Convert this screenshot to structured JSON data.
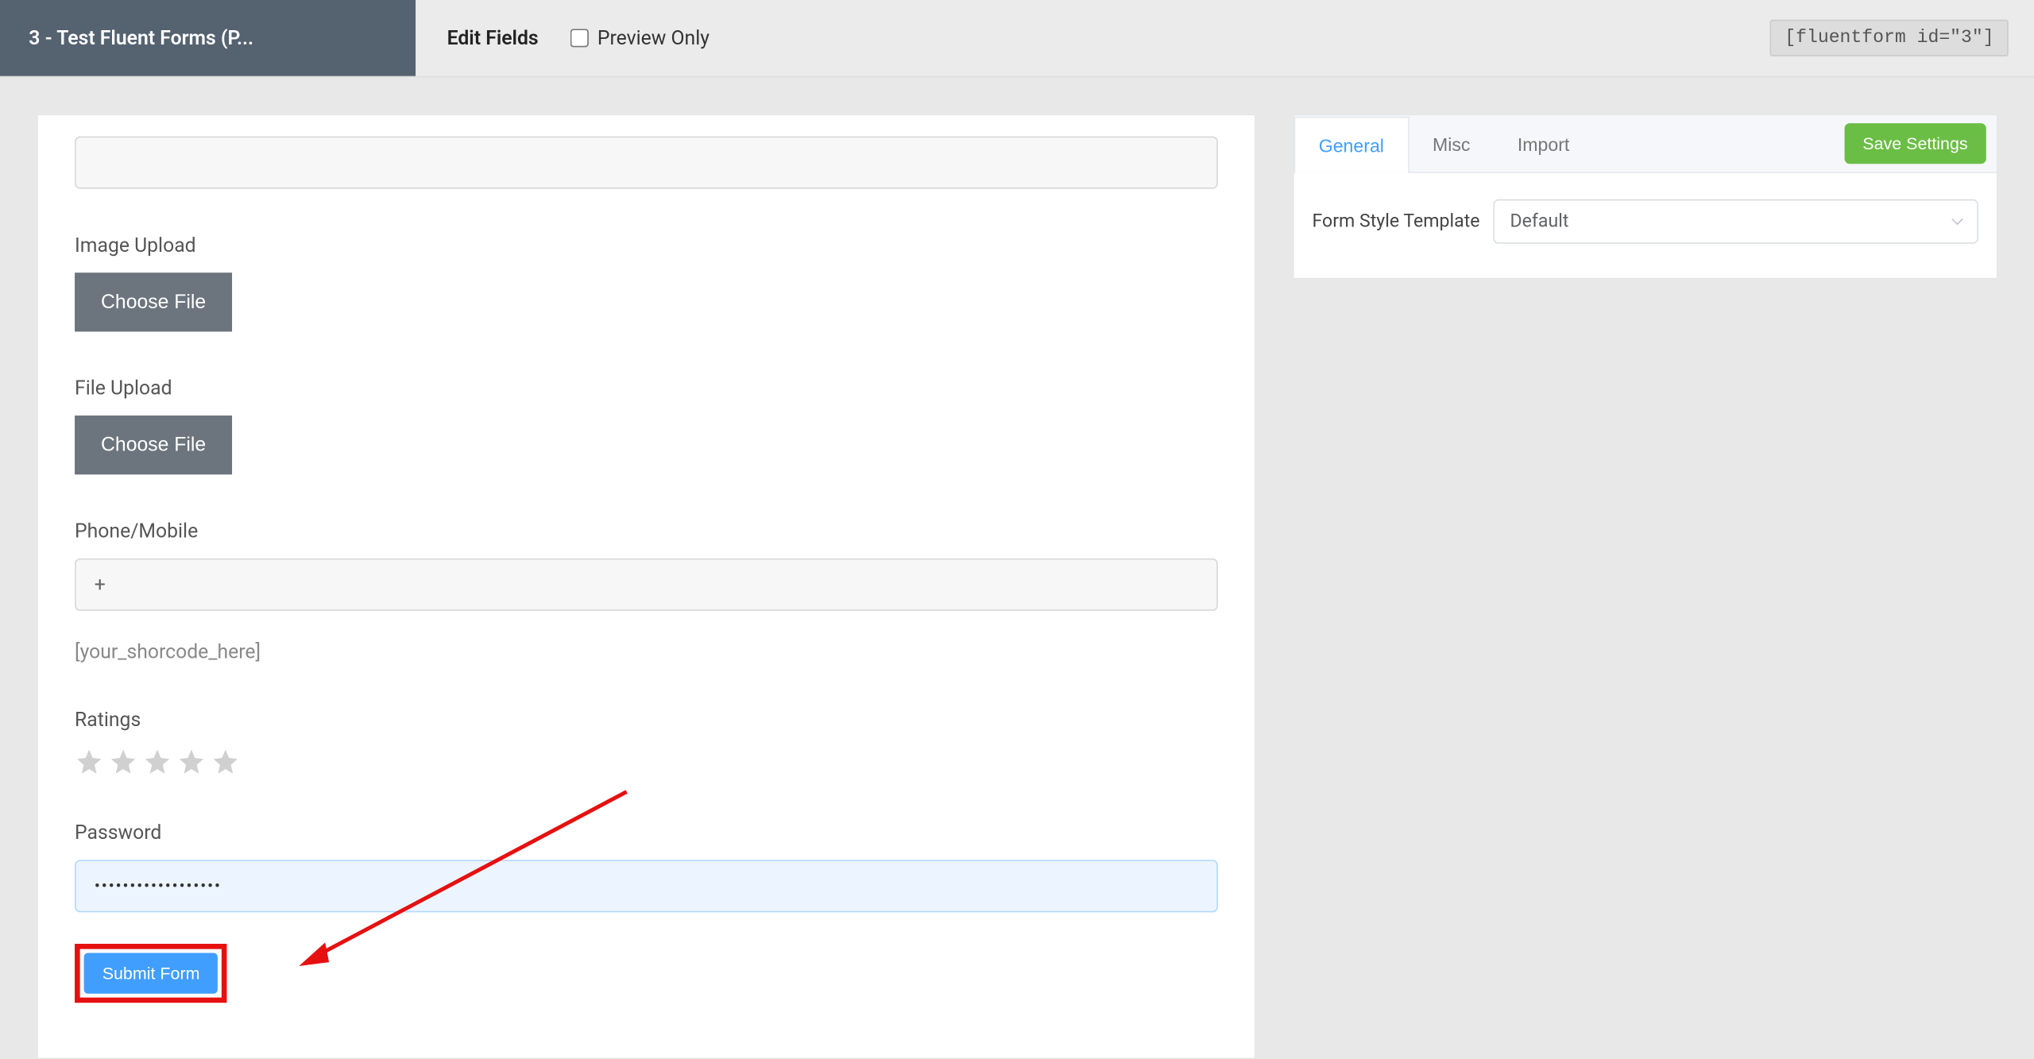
{
  "header": {
    "active_tab": "3 - Test Fluent Forms (P...",
    "edit_fields_label": "Edit Fields",
    "preview_only_label": "Preview Only",
    "shortcode": "[fluentform id=\"3\"]"
  },
  "form": {
    "image_upload_label": "Image Upload",
    "image_upload_button": "Choose File",
    "file_upload_label": "File Upload",
    "file_upload_button": "Choose File",
    "phone_label": "Phone/Mobile",
    "phone_value": "+",
    "shortcode_text": "[your_shorcode_here]",
    "ratings_label": "Ratings",
    "password_label": "Password",
    "password_value": "••••••••••••••••••",
    "submit_button": "Submit Form"
  },
  "right_panel": {
    "tabs": {
      "general": "General",
      "misc": "Misc",
      "import": "Import"
    },
    "save_button": "Save Settings",
    "form_style_label": "Form Style Template",
    "form_style_value": "Default"
  }
}
